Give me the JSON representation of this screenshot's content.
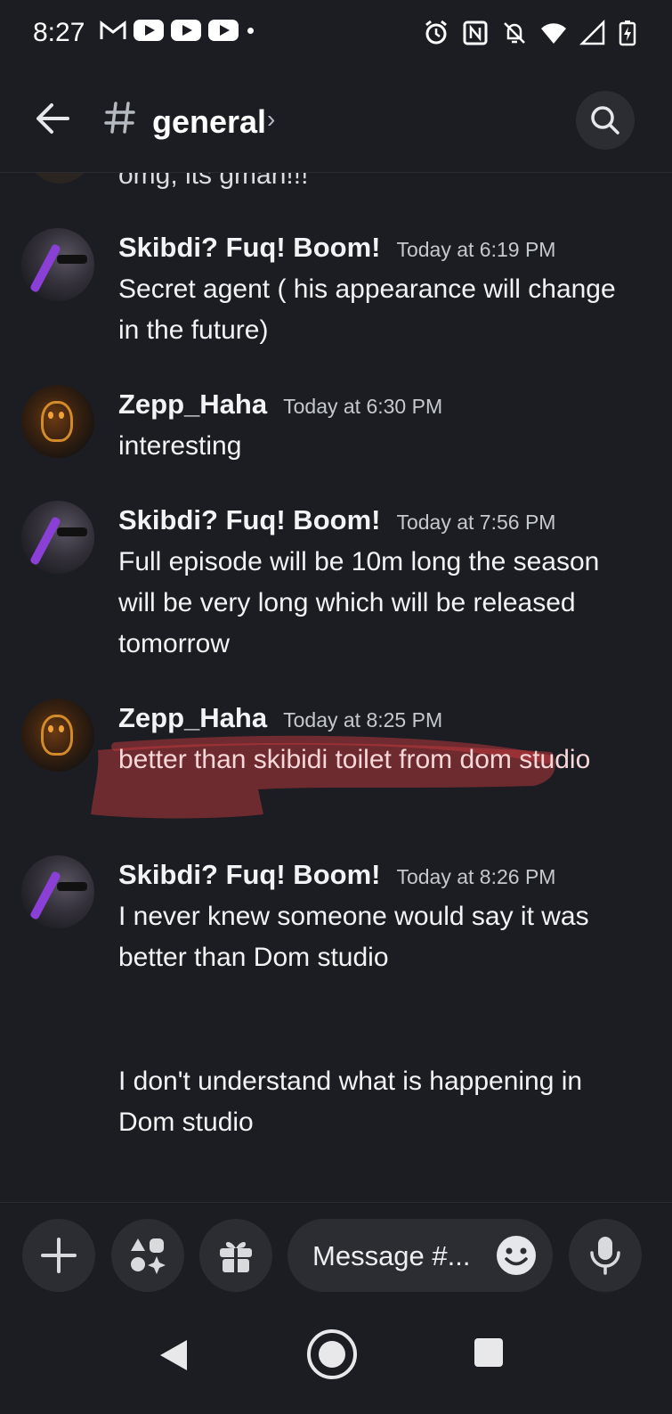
{
  "status_bar": {
    "time": "8:27"
  },
  "header": {
    "hash_symbol": "#",
    "channel_name": "general",
    "chevron": "›"
  },
  "messages": {
    "cut_off_text": "omg, its gman!!!",
    "items": [
      {
        "author": "Skibdi? Fuq! Boom!",
        "timestamp": "Today at 6:19 PM",
        "text": "Secret agent ( his appearance will change in the future)"
      },
      {
        "author": "Zepp_Haha",
        "timestamp": "Today at 6:30 PM",
        "text": "interesting"
      },
      {
        "author": "Skibdi? Fuq! Boom!",
        "timestamp": "Today at 7:56 PM",
        "text": "Full episode will be 10m long the season will be very long which will be released tomorrow"
      },
      {
        "author": "Zepp_Haha",
        "timestamp": "Today at 8:25 PM",
        "text": "better than skibidi toilet from dom studio"
      },
      {
        "author": "Skibdi? Fuq! Boom!",
        "timestamp": "Today at 8:26 PM",
        "text": "I never knew someone would say it was better than Dom studio"
      }
    ],
    "followup_text": "I don't understand what is happening in Dom studio"
  },
  "composer": {
    "placeholder": "Message #..."
  },
  "colors": {
    "background": "#1c1d22",
    "surface": "#2b2d33",
    "scribble": "#b3363a",
    "text": "#f2f3f5"
  }
}
